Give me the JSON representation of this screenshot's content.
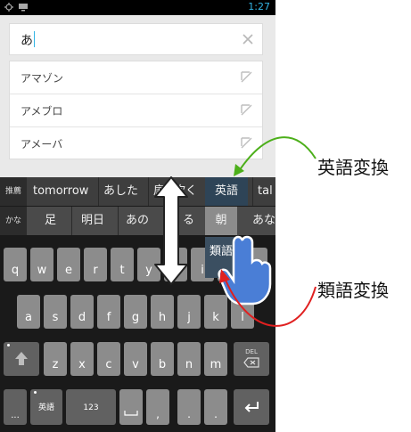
{
  "status_bar": {
    "time": "1:27"
  },
  "search": {
    "query": "あ"
  },
  "suggestions": [
    {
      "label": "アマゾン"
    },
    {
      "label": "アメブロ"
    },
    {
      "label": "アメーバ"
    }
  ],
  "keyboard": {
    "row1": {
      "side_label": "推薦",
      "candidates": [
        "tomorrow",
        "あした",
        "扉",
        "吹く",
        "英語",
        "tal"
      ]
    },
    "row2": {
      "side_label": "かな",
      "candidates": [
        "足",
        "明日",
        "あの",
        "る",
        "朝",
        "あな"
      ]
    },
    "dropdown_item": "類語",
    "keys_row1": [
      "q",
      "w",
      "e",
      "r",
      "t",
      "y",
      "u",
      "i",
      "o",
      "p"
    ],
    "keys_row2": [
      "a",
      "s",
      "d",
      "f",
      "g",
      "h",
      "j",
      "k",
      "l"
    ],
    "keys_row3": [
      "z",
      "x",
      "c",
      "v",
      "b",
      "n",
      "m"
    ],
    "delete_label": "DEL",
    "bottom": {
      "dots": "...",
      "eigo": "英語",
      "num": "123"
    }
  },
  "annotations": {
    "english_conversion": "英語変換",
    "synonym_conversion": "類語変換"
  },
  "colors": {
    "green_arrow": "#4caf1a",
    "red_arrow": "#e02020",
    "drag_arrow_fill": "#ffffff",
    "hand": "#4a7ed6"
  }
}
